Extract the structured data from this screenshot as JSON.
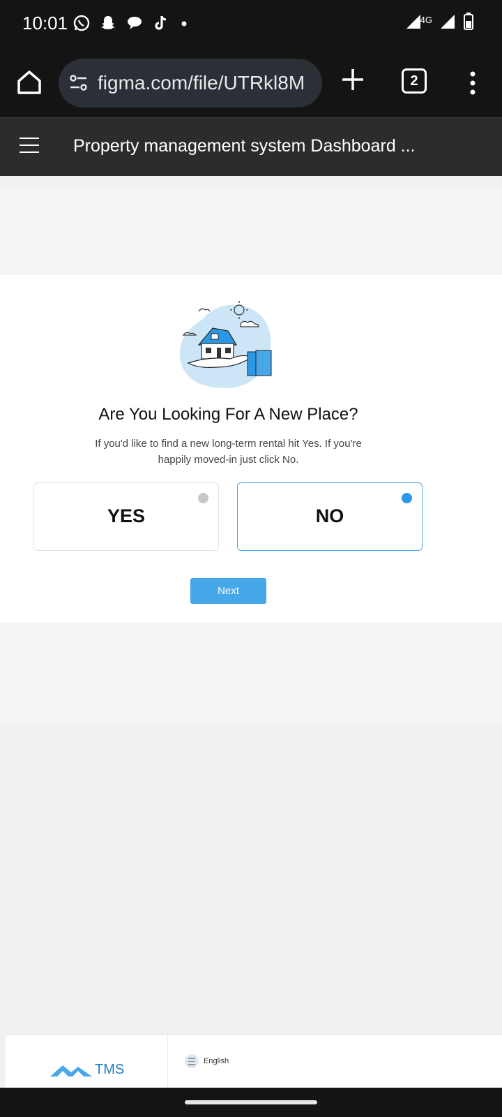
{
  "status_bar": {
    "time": "10:01",
    "network": "4G",
    "notification_icons": [
      "whatsapp-icon",
      "snapchat-icon",
      "chat-bubble-icon",
      "tiktok-icon",
      "dot-icon"
    ],
    "system_icons": [
      "signal-icon",
      "signal-icon",
      "battery-icon"
    ]
  },
  "browser": {
    "url": "figma.com/file/UTRkl8M",
    "tab_count": "2"
  },
  "figma": {
    "title": "Property management system Dashboard ..."
  },
  "dialog": {
    "question": "Are You Looking For A New Place?",
    "description": "If you'd like to find a new long-term rental hit Yes. If you're happily moved-in just click No.",
    "options": [
      {
        "label": "YES",
        "selected": false
      },
      {
        "label": "NO",
        "selected": true
      }
    ],
    "next_label": "Next"
  },
  "footer": {
    "brand": "TMS",
    "language": "English"
  },
  "colors": {
    "accent": "#46a7e9",
    "radio_selected": "#2b98e6",
    "brand_text": "#1f7fc3"
  }
}
